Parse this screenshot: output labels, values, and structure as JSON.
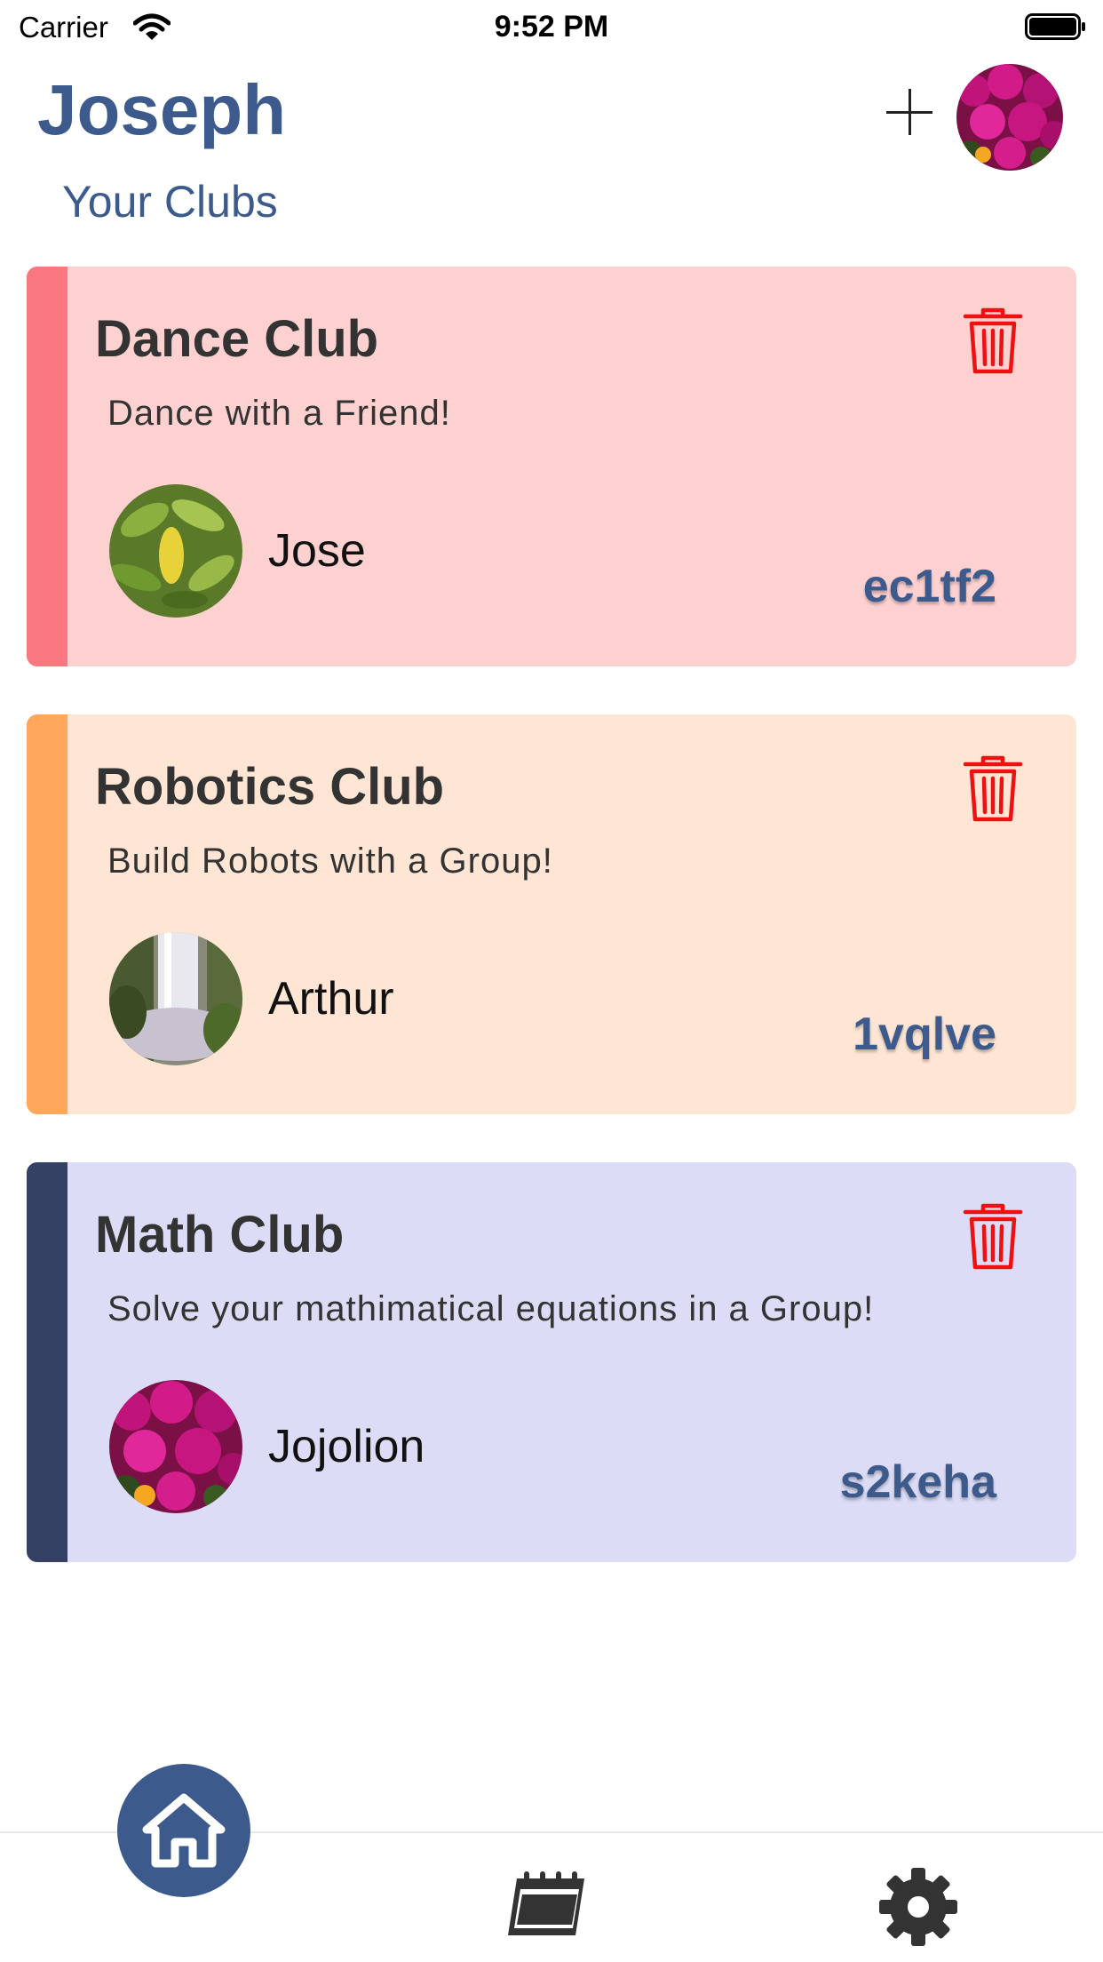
{
  "status_bar": {
    "carrier": "Carrier",
    "time": "9:52 PM"
  },
  "header": {
    "user_name": "Joseph",
    "section_title": "Your Clubs",
    "add_icon": "plus-icon",
    "avatar_image": "pink-flowers-photo"
  },
  "clubs": [
    {
      "name": "Dance Club",
      "description": "Dance with a Friend!",
      "owner": "Jose",
      "code": "ec1tf2",
      "owner_image": "green-leaves-photo",
      "accent_color": "#f9777f",
      "background_color": "#fed1d1"
    },
    {
      "name": "Robotics Club",
      "description": "Build Robots with a Group!",
      "owner": "Arthur",
      "code": "1vqlve",
      "owner_image": "waterfall-photo",
      "accent_color": "#ffa85c",
      "background_color": "#ffe6d4"
    },
    {
      "name": "Math Club",
      "description": "Solve your mathimatical equations in a Group!",
      "owner": "Jojolion",
      "code": "s2keha",
      "owner_image": "pink-flowers-photo",
      "accent_color": "#354164",
      "background_color": "#dcdcf6"
    }
  ],
  "bottom_nav": {
    "items": [
      "home-icon",
      "calendar-icon",
      "gear-icon"
    ],
    "active": "home-icon",
    "active_color": "#3d5a8c"
  },
  "colors": {
    "primary": "#3d5a8c",
    "delete": "#ee1111"
  }
}
